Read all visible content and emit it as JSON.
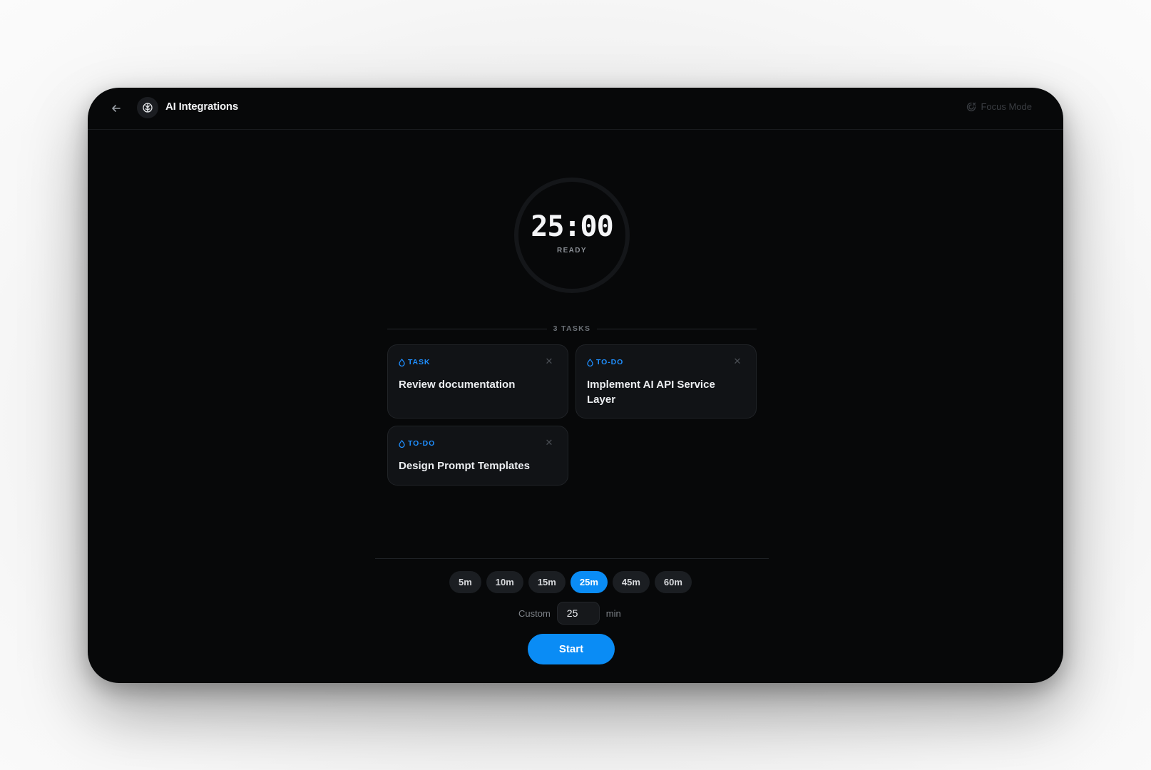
{
  "header": {
    "title": "AI Integrations",
    "back_icon": "arrow-left-icon",
    "app_icon": "brain-icon",
    "focus_mode_label": "Focus Mode",
    "focus_mode_icon": "focus-eye-icon"
  },
  "timer": {
    "time": "25:00",
    "status": "READY"
  },
  "tasks": {
    "count_label": "3 TASKS",
    "items": [
      {
        "tag": "TASK",
        "title": "Review documentation"
      },
      {
        "tag": "TO-DO",
        "title": "Implement AI API Service Layer"
      },
      {
        "tag": "TO-DO",
        "title": "Design Prompt Templates"
      }
    ]
  },
  "presets": {
    "options": [
      "5m",
      "10m",
      "15m",
      "25m",
      "45m",
      "60m"
    ],
    "selected": "25m"
  },
  "custom": {
    "label": "Custom",
    "value": "25",
    "unit": "min"
  },
  "start_label": "Start",
  "colors": {
    "accent": "#0a8cf5",
    "tag": "#1f8fff",
    "background": "#070809",
    "card": "#111316"
  }
}
